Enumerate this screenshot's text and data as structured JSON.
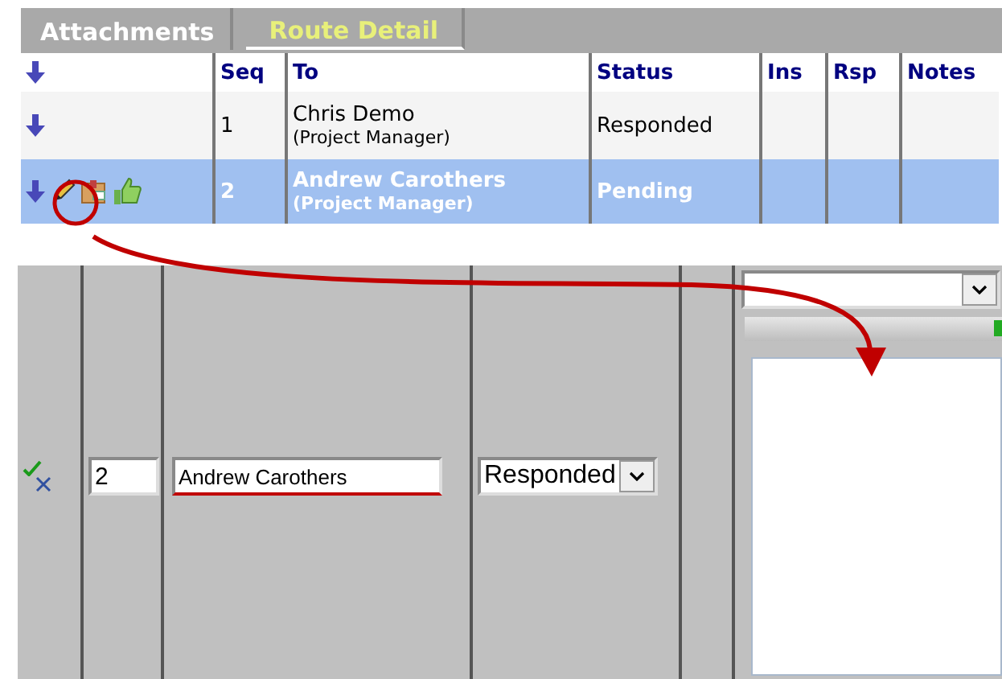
{
  "tabs": [
    {
      "label": "Attachments",
      "selected": false
    },
    {
      "label": "Route Detail",
      "selected": true
    }
  ],
  "table": {
    "columns": [
      "Seq",
      "To",
      "Status",
      "Ins",
      "Rsp",
      "Notes"
    ],
    "rows": [
      {
        "seq": "1",
        "name": "Chris Demo",
        "role": "(Project Manager)",
        "status": "Responded",
        "selected": false
      },
      {
        "seq": "2",
        "name": "Andrew Carothers",
        "role": "(Project Manager)",
        "status": "Pending",
        "selected": true
      }
    ]
  },
  "editor": {
    "seq": "2",
    "name": "Andrew Carothers",
    "name_invalid": true,
    "status": "Responded"
  }
}
